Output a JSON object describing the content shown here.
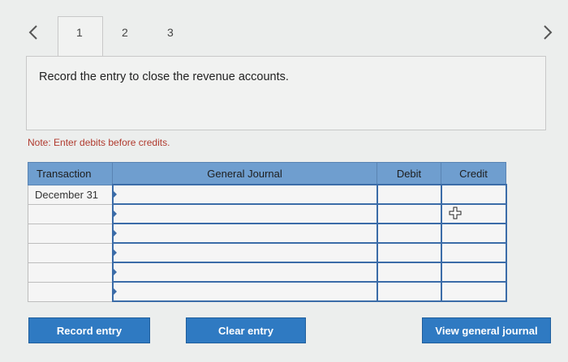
{
  "tabs": [
    "1",
    "2",
    "3"
  ],
  "active_tab": "1",
  "instruction": "Record the entry to close the revenue accounts.",
  "note": "Note: Enter debits before credits.",
  "table": {
    "headers": [
      "Transaction",
      "General Journal",
      "Debit",
      "Credit"
    ],
    "rows": [
      {
        "transaction": "December 31"
      },
      {
        "transaction": ""
      },
      {
        "transaction": ""
      },
      {
        "transaction": ""
      },
      {
        "transaction": ""
      },
      {
        "transaction": ""
      }
    ]
  },
  "buttons": {
    "record": "Record entry",
    "clear": "Clear entry",
    "view": "View general journal"
  },
  "colors": {
    "header_bg": "#6f9ecf",
    "button_bg": "#2f7ac2",
    "note_text": "#b03a2e",
    "input_border": "#3b6ca8"
  }
}
